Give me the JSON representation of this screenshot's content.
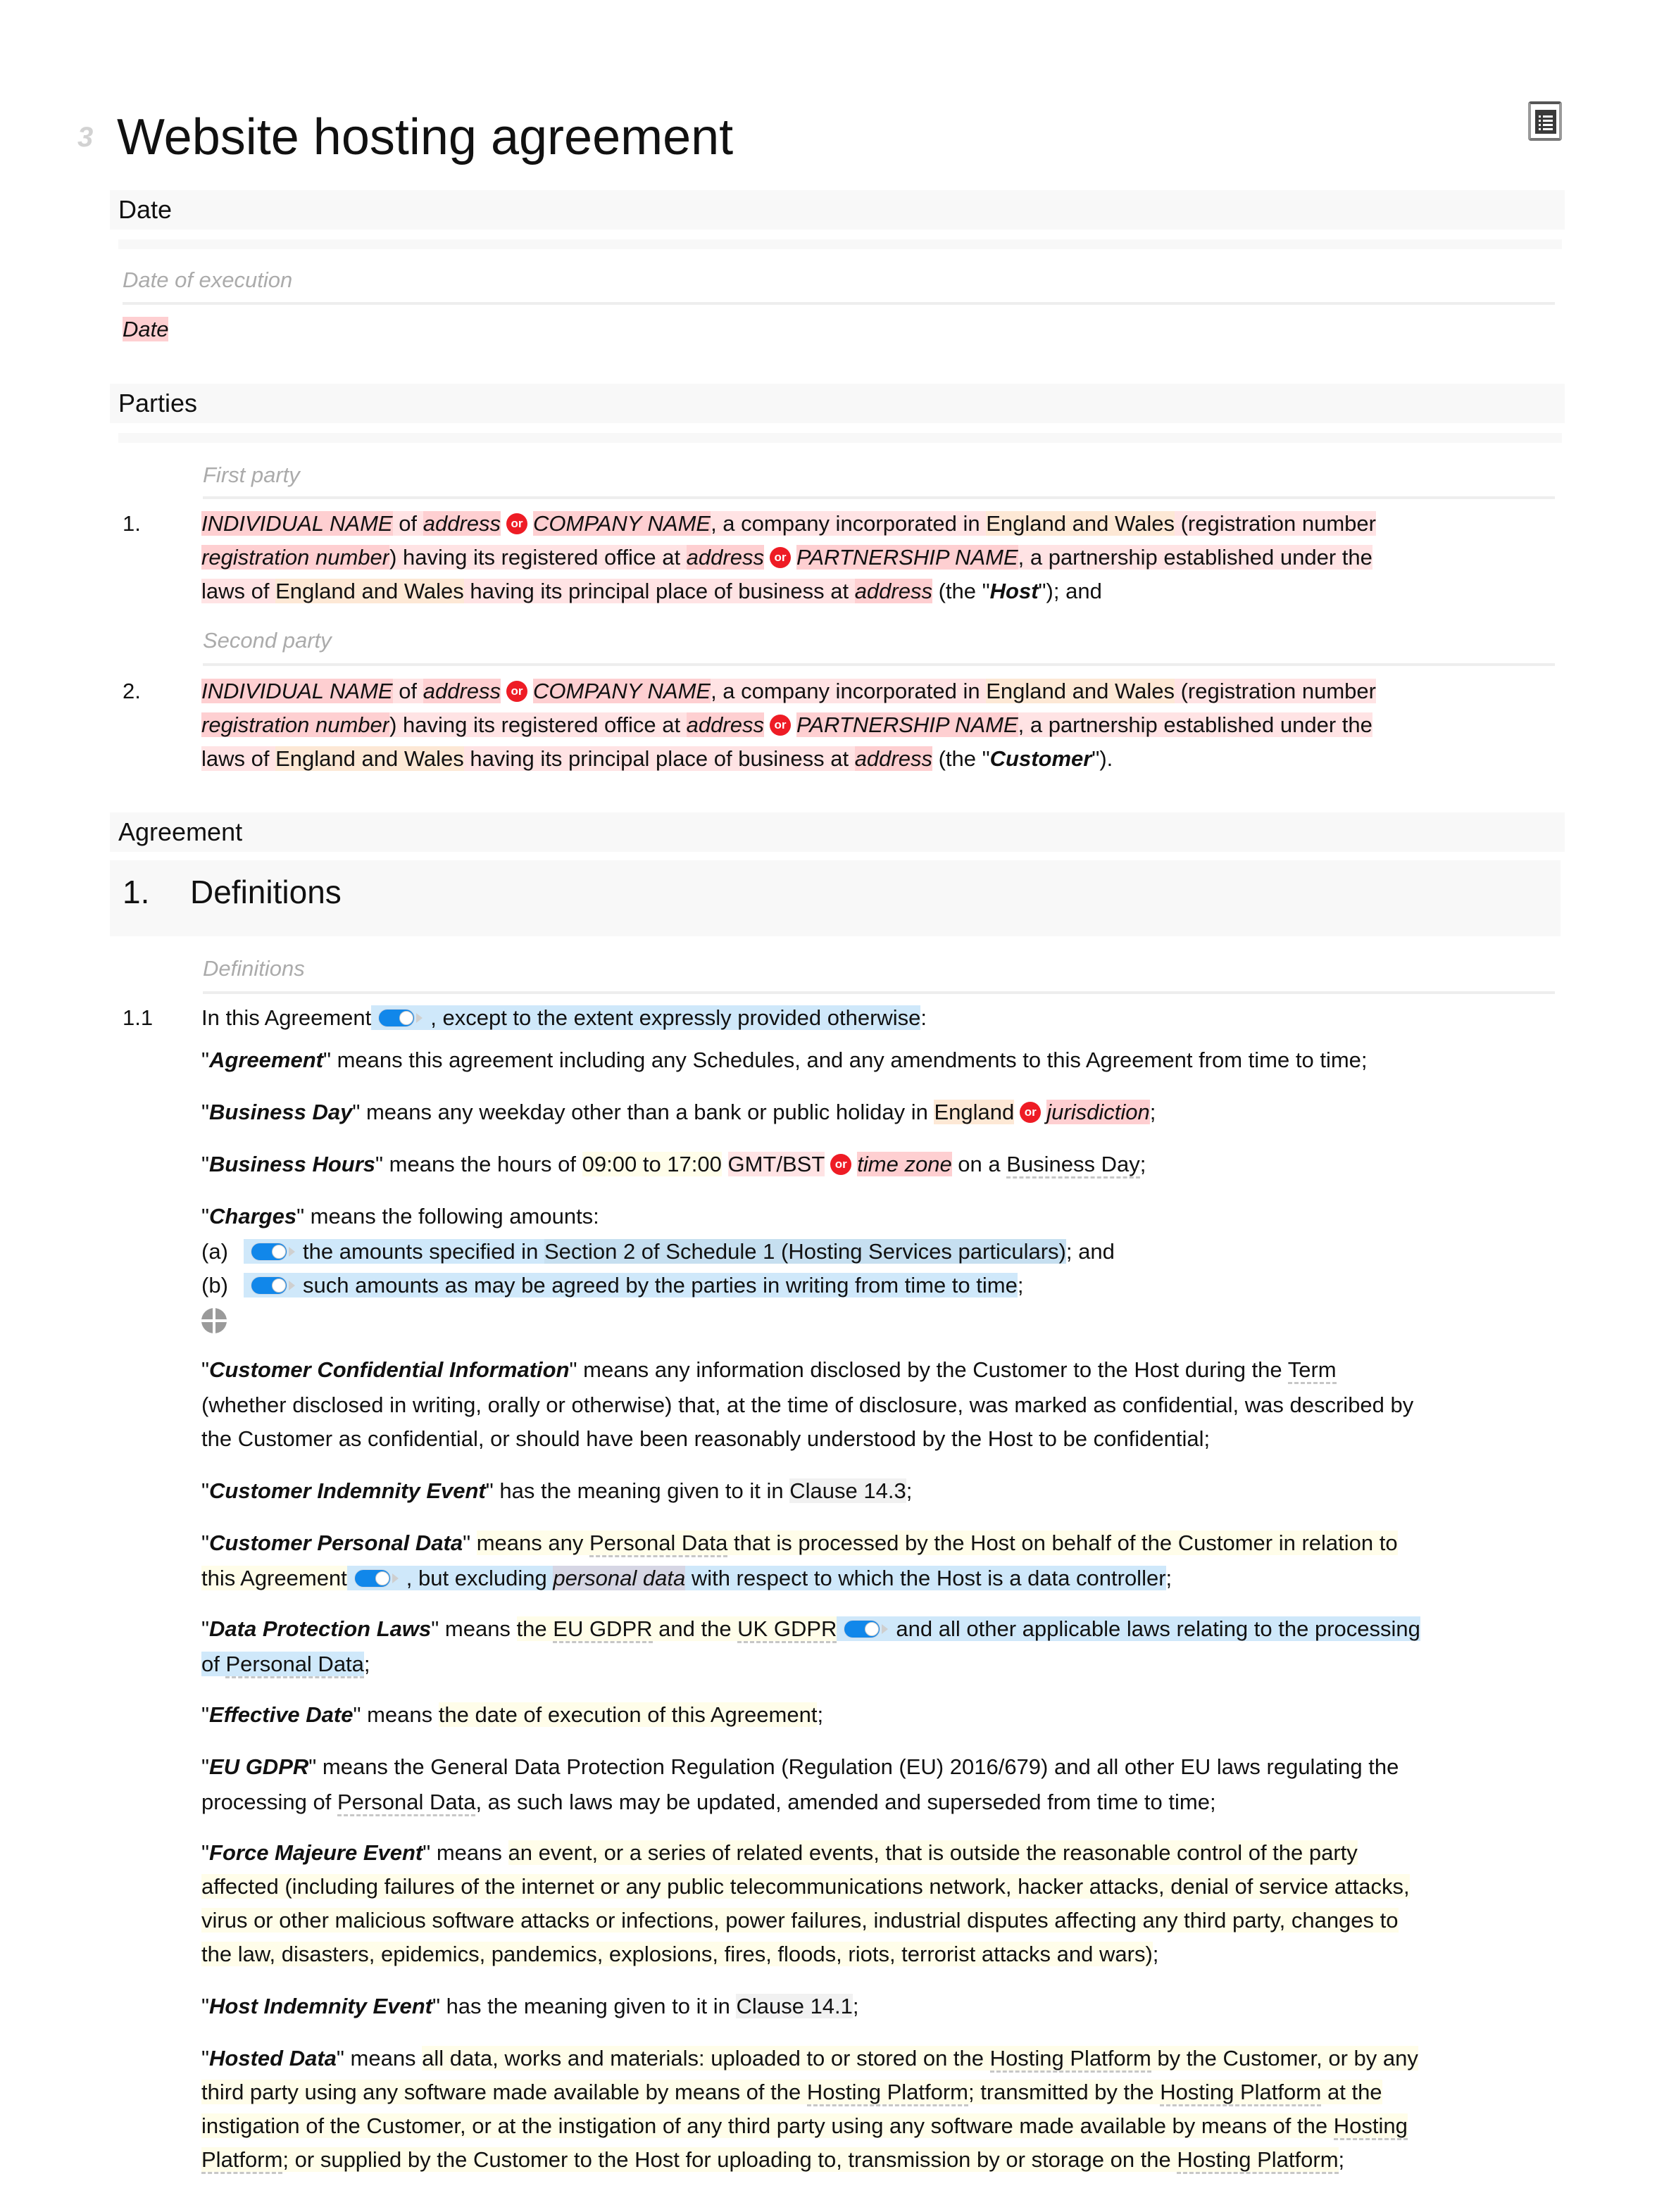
{
  "document": {
    "title": "Website hosting agreement",
    "title_badge_icon": "template-badge-icon",
    "toc_button_icon": "table-of-contents-icon"
  },
  "sections": {
    "date": {
      "heading": "Date",
      "hint": "Date of execution",
      "value": "Date"
    },
    "parties": {
      "heading": "Parties",
      "first_hint": "First party",
      "second_hint": "Second party",
      "items": [
        {
          "num": "1.",
          "individual": "INDIVIDUAL NAME",
          "of": "of",
          "address": "address",
          "company": "COMPANY NAME",
          "company_text": ", a company incorporated in ",
          "jurisdiction": "England and Wales",
          "reg_open": " (registration number ",
          "reg_number": "registration number",
          "reg_close": ") having its registered office at ",
          "partnership": "PARTNERSHIP NAME",
          "partnership_text": ", a partnership established under the",
          "laws_of": "laws of ",
          "principal": " having its principal place of business at ",
          "the_open": " (the \"",
          "defined": "Host",
          "ending": "\"); and"
        },
        {
          "num": "2.",
          "individual": "INDIVIDUAL NAME",
          "of": "of",
          "address": "address",
          "company": "COMPANY NAME",
          "company_text": ", a company incorporated in ",
          "jurisdiction": "England and Wales",
          "reg_open": " (registration number ",
          "reg_number": "registration number",
          "reg_close": ") having its registered office at ",
          "partnership": "PARTNERSHIP NAME",
          "partnership_text": ", a partnership established under the",
          "laws_of": "laws of ",
          "principal": " having its principal place of business at ",
          "the_open": " (the \"",
          "defined": "Customer",
          "ending": "\")."
        }
      ],
      "or_label": "or"
    },
    "agreement": {
      "heading": "Agreement",
      "clause_num": "1.",
      "clause_title": "Definitions",
      "hint": "Definitions",
      "sub_num": "1.1",
      "intro": {
        "a": "In this Agreement",
        "b": ", except to the extent expressly provided otherwise",
        "c": ":"
      },
      "defs": {
        "agreement": {
          "term": "Agreement",
          "text": "\" means this agreement including any Schedules, and any amendments to this Agreement from time to time;"
        },
        "business_day": {
          "term": "Business Day",
          "text": "\" means any weekday other than a bank or public holiday in ",
          "opt1": "England",
          "opt2": "jurisdiction",
          "end": ";"
        },
        "business_hours": {
          "term": "Business Hours",
          "text": "\" means the hours of ",
          "hours": "09:00 to 17:00",
          "tz1": "GMT/BST",
          "tz2": "time zone",
          "mid": " on a ",
          "link": "Business Day",
          "end": ";"
        },
        "charges": {
          "term": "Charges",
          "text": "\" means the following amounts:",
          "a_label": "(a)",
          "a_text": "the amounts specified in ",
          "a_ref": "Section 2 of Schedule 1 (Hosting Services particulars)",
          "a_end": "; and",
          "b_label": "(b)",
          "b_text": "such amounts as may be agreed by the parties in writing from time to time",
          "b_end": ";"
        },
        "cci": {
          "term": "Customer Confidential Information",
          "l1": "\" means any information disclosed by the Customer to the Host during the ",
          "l1_link": "Term",
          "l2": "(whether disclosed in writing, orally or otherwise) that, at the time of disclosure, was marked as confidential, was described by",
          "l3": "the Customer as confidential, or should have been reasonably understood by the Host to be confidential;"
        },
        "cie": {
          "term": "Customer Indemnity Event",
          "text": "\" has the meaning given to it in ",
          "ref": "Clause 14.3",
          "end": ";"
        },
        "cpd": {
          "term": "Customer Personal Data",
          "l1a": "\" ",
          "l1b": "means any ",
          "l1_link": "Personal Data",
          "l1c": " that is processed by the Host on behalf of the Customer in relation to",
          "l2a": "this Agreement",
          "l2b": ", but excluding ",
          "l2_var": "personal data",
          "l2c": " with respect to which the Host is a data controller",
          "l2_end": ";"
        },
        "dpl": {
          "term": "Data Protection Laws",
          "l1a": "\" means ",
          "l1b": "the ",
          "link1": "EU GDPR",
          "l1c": " and the ",
          "link2": "UK GDPR",
          "l1d": "and all other applicable laws relating to the processing",
          "l2a": "of ",
          "l2_link": "Personal Data",
          "l2_end": ";"
        },
        "effective": {
          "term": "Effective Date",
          "text": "\" means ",
          "value": "the date of execution of this Agreement",
          "end": ";"
        },
        "eugdpr": {
          "term": "EU GDPR",
          "l1": "\" means the General Data Protection Regulation (Regulation (EU) 2016/679) and all other EU laws regulating the",
          "l2a": "processing of ",
          "l2_link": "Personal Data",
          "l2b": ", as such laws may be updated, amended and superseded from time to time;"
        },
        "fme": {
          "term": "Force Majeure Event",
          "l1a": "\" means ",
          "l1b": "an event, or a series of related events, that is outside the reasonable control of the party",
          "l2": "affected (including failures of the internet or any public telecommunications network, hacker attacks, denial of service attacks,",
          "l3": "virus or other malicious software attacks or infections, power failures, industrial disputes affecting any third party, changes to",
          "l4": "the law, disasters, epidemics, pandemics, explosions, fires, floods, riots, terrorist attacks and wars)",
          "l4_end": ";"
        },
        "hie": {
          "term": "Host Indemnity Event",
          "text": "\" has the meaning given to it in ",
          "ref": "Clause 14.1",
          "end": ";"
        },
        "hosted": {
          "term": "Hosted Data",
          "l1a": "\" means ",
          "l1b": "all data, works and materials: uploaded to or stored on the ",
          "hp": "Hosting Platform",
          "l1c": " by the Customer, or by any",
          "l2a": "third party using any software made available by means of the ",
          "l2b": "; transmitted by the ",
          "l2c": " at the",
          "l3a": "instigation of the Customer, or at the instigation of any third party using any software made available by means of the ",
          "l3_link": "Hosting",
          "l4_link": "Platform",
          "l4a": "; or supplied by the Customer to the Host for uploading to, transmission by or storage on the ",
          "l4_end": ";"
        }
      }
    }
  },
  "colors": {
    "placeholder_pink": "#fecfd1",
    "option_pink": "#ffe3e4",
    "jurisdiction_orange": "#fde8d5",
    "default_yellow": "#fffde9",
    "optional_blue": "#cfe8fa",
    "reference_gray": "#f1f1f1",
    "or_badge_red": "#ee1c25",
    "toggle_blue": "#1187ea"
  }
}
